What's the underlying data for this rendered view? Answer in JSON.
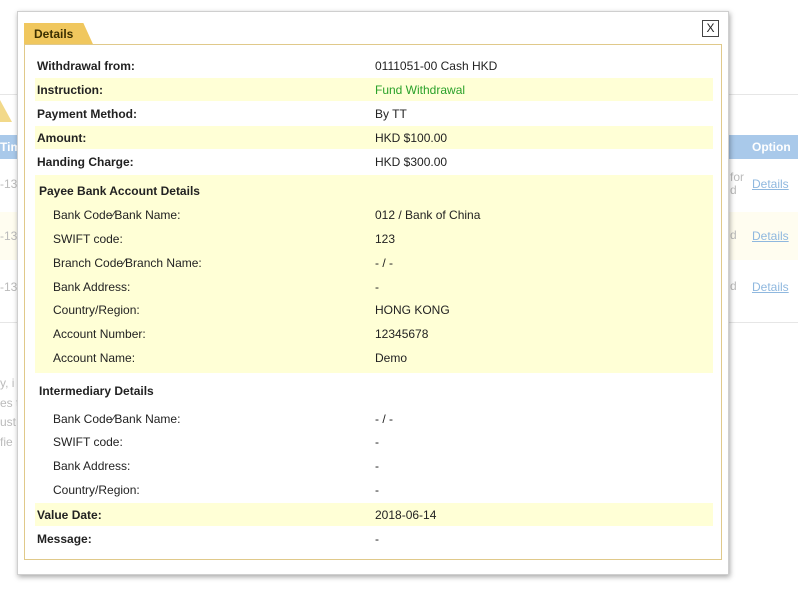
{
  "background": {
    "header_left": "Tim",
    "header_right": "Option",
    "rows": [
      {
        "date": "-13",
        "status": "for d",
        "link": "Details"
      },
      {
        "date": "-13",
        "status": "d",
        "link": "Details"
      },
      {
        "date": "-13",
        "status": "d",
        "link": "Details"
      }
    ],
    "notes": [
      "y, i",
      "es t",
      "ust",
      "fie"
    ]
  },
  "dialog": {
    "title": "Details",
    "close_label": "X",
    "fields": [
      {
        "label": "Withdrawal from:",
        "value": "0111051-00 Cash HKD"
      },
      {
        "label": "Instruction:",
        "value": "Fund Withdrawal"
      },
      {
        "label": "Payment Method:",
        "value": "By TT"
      },
      {
        "label": "Amount:",
        "value": "HKD $100.00"
      },
      {
        "label": "Handing Charge:",
        "value": "HKD $300.00"
      }
    ],
    "payee": {
      "title": "Payee Bank Account Details",
      "rows": [
        {
          "label": "Bank Code∕Bank Name:",
          "value": "012 / Bank of China"
        },
        {
          "label": "SWIFT code:",
          "value": "123"
        },
        {
          "label": "Branch Code∕Branch Name:",
          "value": "- / -"
        },
        {
          "label": "Bank Address:",
          "value": "-"
        },
        {
          "label": "Country/Region:",
          "value": "HONG KONG"
        },
        {
          "label": "Account Number:",
          "value": "12345678"
        },
        {
          "label": "Account Name:",
          "value": "Demo"
        }
      ]
    },
    "intermediary": {
      "title": "Intermediary Details",
      "rows": [
        {
          "label": "Bank Code∕Bank Name:",
          "value": "- / -"
        },
        {
          "label": "SWIFT code:",
          "value": "-"
        },
        {
          "label": "Bank Address:",
          "value": "-"
        },
        {
          "label": "Country/Region:",
          "value": "-"
        }
      ]
    },
    "footer_fields": [
      {
        "label": "Value Date:",
        "value": "2018-06-14"
      },
      {
        "label": "Message:",
        "value": "-"
      }
    ],
    "colors": {
      "accent": "#f0c75e",
      "highlight": "#ffffd6",
      "instruction": "#2aa12a",
      "link": "#8fb8df"
    }
  }
}
